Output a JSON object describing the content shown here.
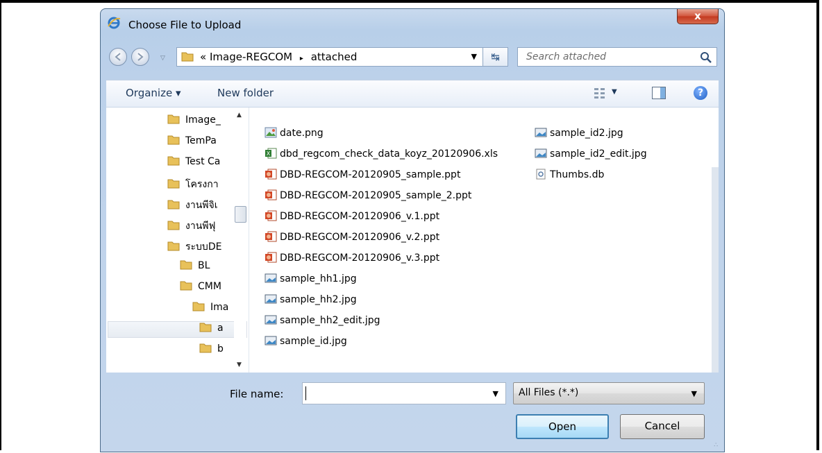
{
  "window": {
    "title": "Choose File to Upload",
    "close_label": "x"
  },
  "address": {
    "prefix": "«",
    "path": [
      "Image-REGCOM",
      "attached"
    ],
    "separator": "▸"
  },
  "search": {
    "placeholder": "Search attached"
  },
  "toolbar": {
    "organize": "Organize ▾",
    "new_folder": "New folder",
    "help": "?"
  },
  "tree": {
    "items": [
      {
        "label": "Image_",
        "indent": 0
      },
      {
        "label": "TemPa",
        "indent": 0
      },
      {
        "label": "Test Ca",
        "indent": 0
      },
      {
        "label": "โครงกา",
        "indent": 0
      },
      {
        "label": "งานพีจิเ",
        "indent": 0
      },
      {
        "label": "งานพีฟุ",
        "indent": 0
      },
      {
        "label": "ระบบDE",
        "indent": 0
      },
      {
        "label": "BL",
        "indent": 1
      },
      {
        "label": "CMM",
        "indent": 1
      },
      {
        "label": "Ima",
        "indent": 2
      },
      {
        "label": "a",
        "indent": 3
      },
      {
        "label": "b",
        "indent": 3
      }
    ]
  },
  "files": {
    "col1": [
      {
        "name": "date.png",
        "type": "png"
      },
      {
        "name": "dbd_regcom_check_data_koyz_20120906.xls",
        "type": "xls"
      },
      {
        "name": "DBD-REGCOM-20120905_sample.ppt",
        "type": "ppt"
      },
      {
        "name": "DBD-REGCOM-20120905_sample_2.ppt",
        "type": "ppt"
      },
      {
        "name": "DBD-REGCOM-20120906_v.1.ppt",
        "type": "ppt"
      },
      {
        "name": "DBD-REGCOM-20120906_v.2.ppt",
        "type": "ppt"
      },
      {
        "name": "DBD-REGCOM-20120906_v.3.ppt",
        "type": "ppt"
      },
      {
        "name": "sample_hh1.jpg",
        "type": "jpg"
      },
      {
        "name": "sample_hh2.jpg",
        "type": "jpg"
      },
      {
        "name": "sample_hh2_edit.jpg",
        "type": "jpg"
      },
      {
        "name": "sample_id.jpg",
        "type": "jpg"
      }
    ],
    "col2": [
      {
        "name": "sample_id2.jpg",
        "type": "jpg"
      },
      {
        "name": "sample_id2_edit.jpg",
        "type": "jpg"
      },
      {
        "name": "Thumbs.db",
        "type": "db"
      }
    ]
  },
  "footer": {
    "filename_label": "File name:",
    "filename_value": "",
    "filter_value": "All Files (*.*)",
    "open_label": "Open",
    "cancel_label": "Cancel"
  },
  "colors": {
    "folder": "#e8c15a",
    "accent": "#3c7fb1",
    "close": "#c3381f"
  }
}
